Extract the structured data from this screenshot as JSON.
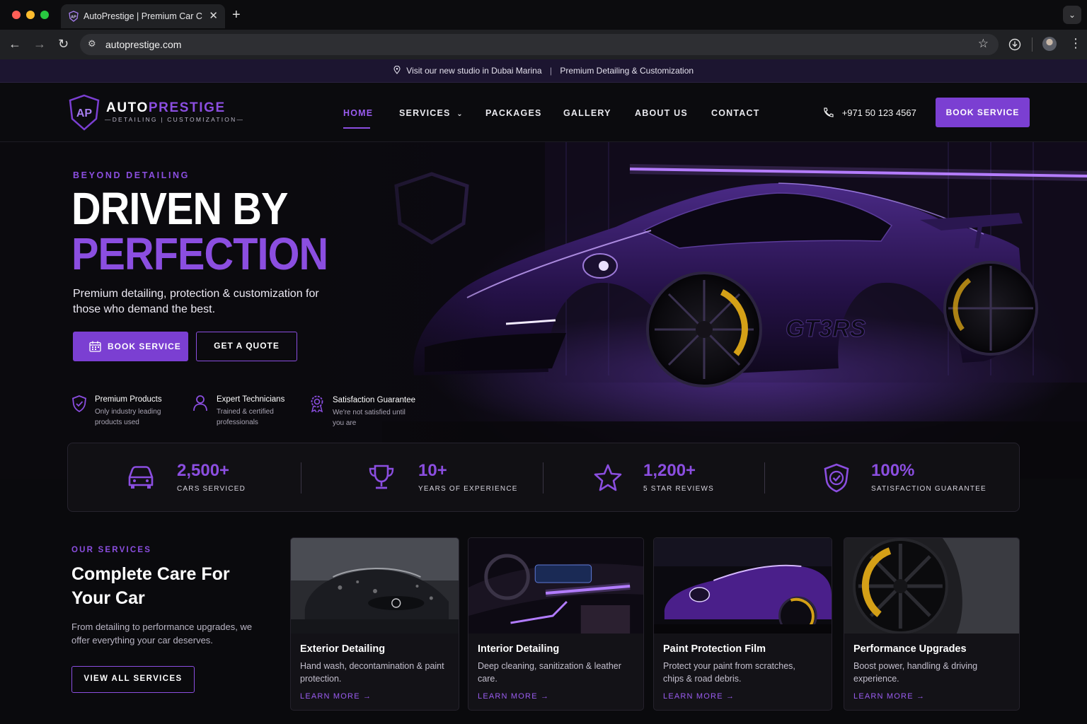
{
  "browser": {
    "tab_title": "AutoPrestige | Premium Car C",
    "url": "autoprestige.com",
    "tab_favicon_text": "AP"
  },
  "announcement": {
    "left": "Visit our new studio in Dubai Marina",
    "separator": "|",
    "right": "Premium Detailing & Customization"
  },
  "header": {
    "logo_monogram": "AP",
    "logo_word_a": "AUTO",
    "logo_word_b": "PRESTIGE",
    "logo_tagline": "—DETAILING | CUSTOMIZATION—",
    "nav": [
      "HOME",
      "SERVICES",
      "PACKAGES",
      "GALLERY",
      "ABOUT US",
      "CONTACT"
    ],
    "phone": "+971 50 123 4567",
    "cta": "BOOK SERVICE"
  },
  "hero": {
    "eyebrow": "BEYOND DETAILING",
    "title_line1": "DRIVEN BY",
    "title_line2": "PERFECTION",
    "subtitle": "Premium detailing, protection & customization for those who demand the best.",
    "primary_cta": "BOOK SERVICE",
    "secondary_cta": "GET A QUOTE",
    "plate_text": "GT3RS",
    "features": [
      {
        "title": "Premium Products",
        "desc": "Only industry leading products used"
      },
      {
        "title": "Expert Technicians",
        "desc": "Trained & certified professionals"
      },
      {
        "title": "Satisfaction Guarantee",
        "desc": "We're not satisfied until you are"
      }
    ]
  },
  "stats": [
    {
      "value": "2,500+",
      "label": "CARS SERVICED",
      "icon": "car-icon"
    },
    {
      "value": "10+",
      "label": "YEARS OF EXPERIENCE",
      "icon": "trophy-icon"
    },
    {
      "value": "1,200+",
      "label": "5 STAR REVIEWS",
      "icon": "star-icon"
    },
    {
      "value": "100%",
      "label": "SATISFACTION GUARANTEE",
      "icon": "shield-check-icon"
    }
  ],
  "services": {
    "eyebrow": "OUR SERVICES",
    "title": "Complete Care For Your Car",
    "subtitle": "From detailing to performance upgrades, we offer everything your car deserves.",
    "cta": "VIEW ALL SERVICES",
    "cards": [
      {
        "title": "Exterior Detailing",
        "desc": "Hand wash, decontamination & paint protection.",
        "link": "LEARN MORE"
      },
      {
        "title": "Interior Detailing",
        "desc": "Deep cleaning, sanitization & leather care.",
        "link": "LEARN MORE"
      },
      {
        "title": "Paint Protection Film",
        "desc": "Protect your paint from scratches, chips & road debris.",
        "link": "LEARN MORE"
      },
      {
        "title": "Performance Upgrades",
        "desc": "Boost power, handling & driving experience.",
        "link": "LEARN MORE"
      }
    ]
  },
  "colors": {
    "accent": "#8b4ee0",
    "button": "#7b3fd2",
    "background": "#0a0a0d"
  }
}
